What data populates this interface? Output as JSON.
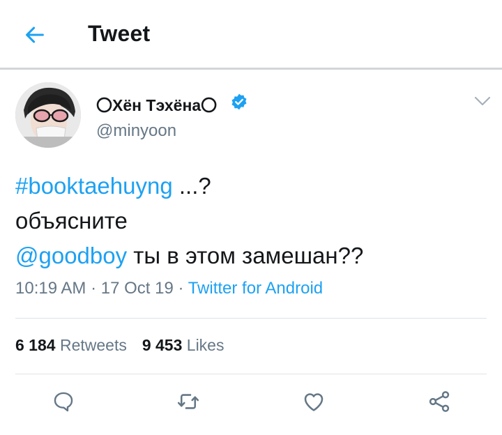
{
  "header": {
    "title": "Tweet",
    "back_icon": "arrow-left-icon"
  },
  "tweet": {
    "author_name": "〇Хён Тэхёна〇",
    "verified_icon": "verified-badge-icon",
    "handle": "@minyoon",
    "menu_icon": "chevron-down-icon",
    "text": {
      "hashtag": "#booktaehuyng",
      "line1_rest": " ...?",
      "line2": "объясните",
      "mention": "@goodboy",
      "line3_rest": " ты в этом замешан??"
    },
    "time": "10:19 AM",
    "separator1": " · ",
    "date": "17 Oct 19",
    "separator2": " · ",
    "source": "Twitter for Android",
    "retweets_count": "6 184",
    "retweets_label": "Retweets",
    "likes_count": "9 453",
    "likes_label": "Likes"
  },
  "actions": [
    "reply-icon",
    "retweet-icon",
    "like-icon",
    "share-icon"
  ],
  "colors": {
    "accent": "#1da1f2",
    "secondary_text": "#657786",
    "primary_text": "#14171a"
  }
}
